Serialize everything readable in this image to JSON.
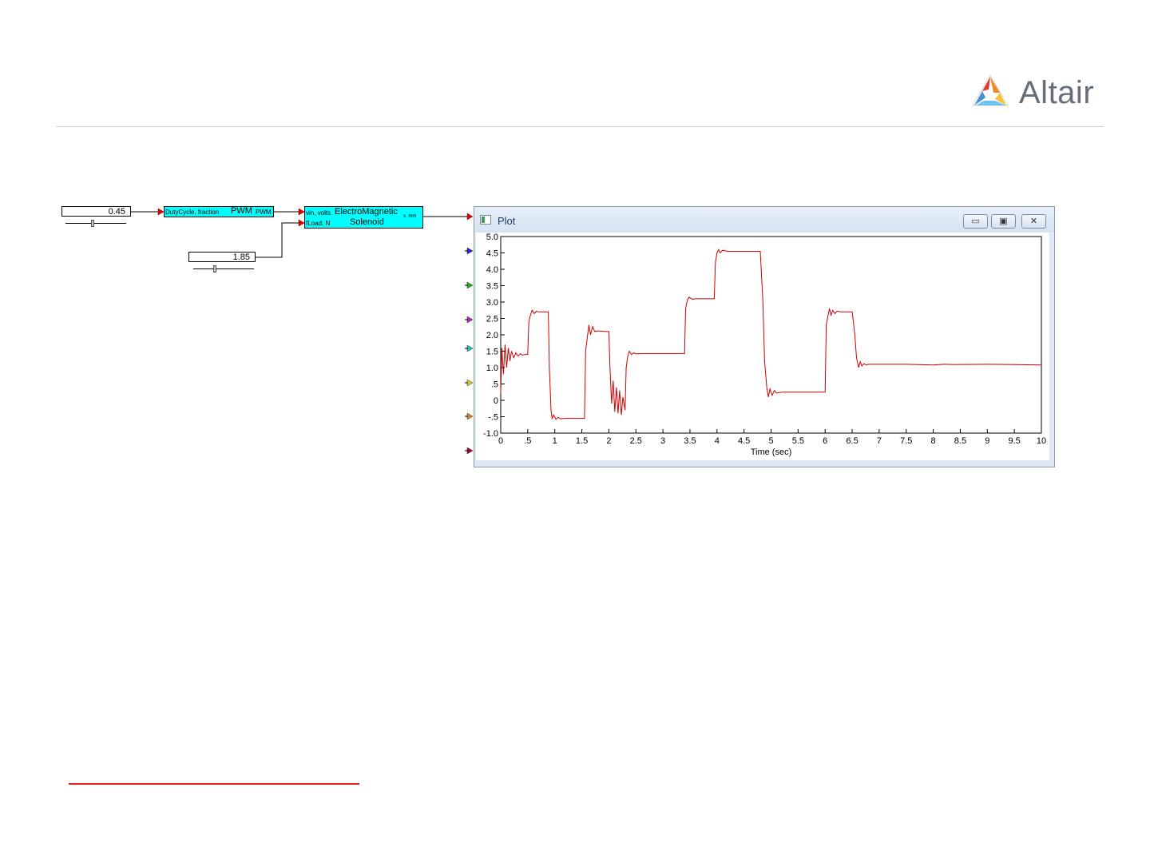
{
  "brand": {
    "name": "Altair"
  },
  "diagram": {
    "const_duty": {
      "value": "0.45",
      "slider_fraction": 0.45
    },
    "const_load": {
      "value": "1.85",
      "slider_fraction": 0.36
    },
    "pwm_block": {
      "input_label": "DutyCycle, fraction",
      "title": "PWM",
      "output_label": "PWM"
    },
    "solenoid_block": {
      "input_vin": "vin, volts",
      "input_load": "fLoad, N",
      "title_line1": "ElectroMagnetic",
      "title_line2": "Solenoid",
      "output_label": "x, mm"
    },
    "plot_input_colors": [
      "#e00000",
      "#2020e0",
      "#20b020",
      "#c020c0",
      "#20c0c0",
      "#d0d020",
      "#e08020",
      "#a00040"
    ]
  },
  "plot_window": {
    "title": "Plot",
    "buttons": {
      "minimize": "▭",
      "restore": "▣",
      "close": "✕"
    }
  },
  "chart_data": {
    "type": "line",
    "xlabel": "Time (sec)",
    "ylabel": "",
    "xlim": [
      0,
      10
    ],
    "ylim": [
      -1.0,
      5.0
    ],
    "x_tick_labels": [
      "0",
      ".5",
      "1",
      "1.5",
      "2",
      "2.5",
      "3",
      "3.5",
      "4",
      "4.5",
      "5",
      "5.5",
      "6",
      "6.5",
      "7",
      "7.5",
      "8",
      "8.5",
      "9",
      "9.5",
      "10"
    ],
    "y_tick_labels": [
      "5.0",
      "4.5",
      "4.0",
      "3.5",
      "3.0",
      "2.5",
      "2.0",
      "1.5",
      "1.0",
      ".5",
      "0",
      "-.5",
      "-1.0"
    ],
    "series": [
      {
        "color": "#cc0000",
        "x": [
          0,
          0.02,
          0.05,
          0.08,
          0.11,
          0.14,
          0.17,
          0.2,
          0.24,
          0.28,
          0.32,
          0.36,
          0.4,
          0.45,
          0.5,
          0.52,
          0.55,
          0.58,
          0.62,
          0.66,
          0.7,
          0.8,
          0.88,
          0.9,
          0.93,
          0.95,
          0.98,
          1.02,
          1.06,
          1.1,
          1.2,
          1.4,
          1.55,
          1.57,
          1.6,
          1.63,
          1.66,
          1.7,
          1.74,
          1.8,
          1.95,
          2.0,
          2.02,
          2.05,
          2.08,
          2.11,
          2.14,
          2.17,
          2.2,
          2.23,
          2.26,
          2.3,
          2.32,
          2.35,
          2.38,
          2.42,
          2.46,
          2.5,
          2.6,
          3.0,
          3.4,
          3.42,
          3.45,
          3.48,
          3.55,
          3.6,
          3.8,
          3.95,
          3.97,
          4.0,
          4.03,
          4.06,
          4.1,
          4.2,
          4.4,
          4.6,
          4.8,
          4.85,
          4.88,
          4.92,
          4.95,
          4.98,
          5.02,
          5.06,
          5.1,
          5.2,
          5.5,
          6.0,
          6.02,
          6.05,
          6.08,
          6.11,
          6.14,
          6.18,
          6.22,
          6.3,
          6.5,
          6.55,
          6.58,
          6.62,
          6.65,
          6.68,
          6.72,
          6.76,
          6.8,
          7.0,
          7.5,
          8.0,
          8.2,
          8.4,
          9.0,
          9.5,
          10.0
        ],
        "y": [
          0.2,
          1.6,
          0.8,
          1.7,
          1.0,
          1.6,
          1.2,
          1.5,
          1.3,
          1.45,
          1.35,
          1.42,
          1.38,
          1.4,
          1.4,
          2.4,
          2.6,
          2.75,
          2.65,
          2.72,
          2.7,
          2.7,
          2.7,
          1.0,
          -0.3,
          -0.55,
          -0.45,
          -0.58,
          -0.52,
          -0.56,
          -0.55,
          -0.55,
          -0.55,
          1.5,
          1.9,
          2.3,
          2.0,
          2.25,
          2.1,
          2.12,
          2.1,
          2.1,
          1.0,
          -0.1,
          0.6,
          -0.35,
          0.4,
          -0.4,
          0.3,
          -0.45,
          0.1,
          -0.3,
          1.0,
          1.35,
          1.5,
          1.4,
          1.45,
          1.42,
          1.43,
          1.43,
          1.43,
          2.8,
          3.05,
          3.15,
          3.08,
          3.1,
          3.1,
          3.1,
          4.2,
          4.5,
          4.6,
          4.5,
          4.58,
          4.55,
          4.55,
          4.55,
          4.55,
          3.0,
          1.2,
          0.4,
          0.1,
          0.35,
          0.15,
          0.3,
          0.22,
          0.25,
          0.25,
          0.25,
          2.3,
          2.55,
          2.8,
          2.6,
          2.75,
          2.65,
          2.72,
          2.7,
          2.7,
          2.0,
          1.3,
          1.0,
          1.18,
          1.05,
          1.12,
          1.08,
          1.1,
          1.1,
          1.1,
          1.08,
          1.1,
          1.09,
          1.1,
          1.09,
          1.08
        ]
      }
    ],
    "grid": false,
    "legend": "none"
  }
}
